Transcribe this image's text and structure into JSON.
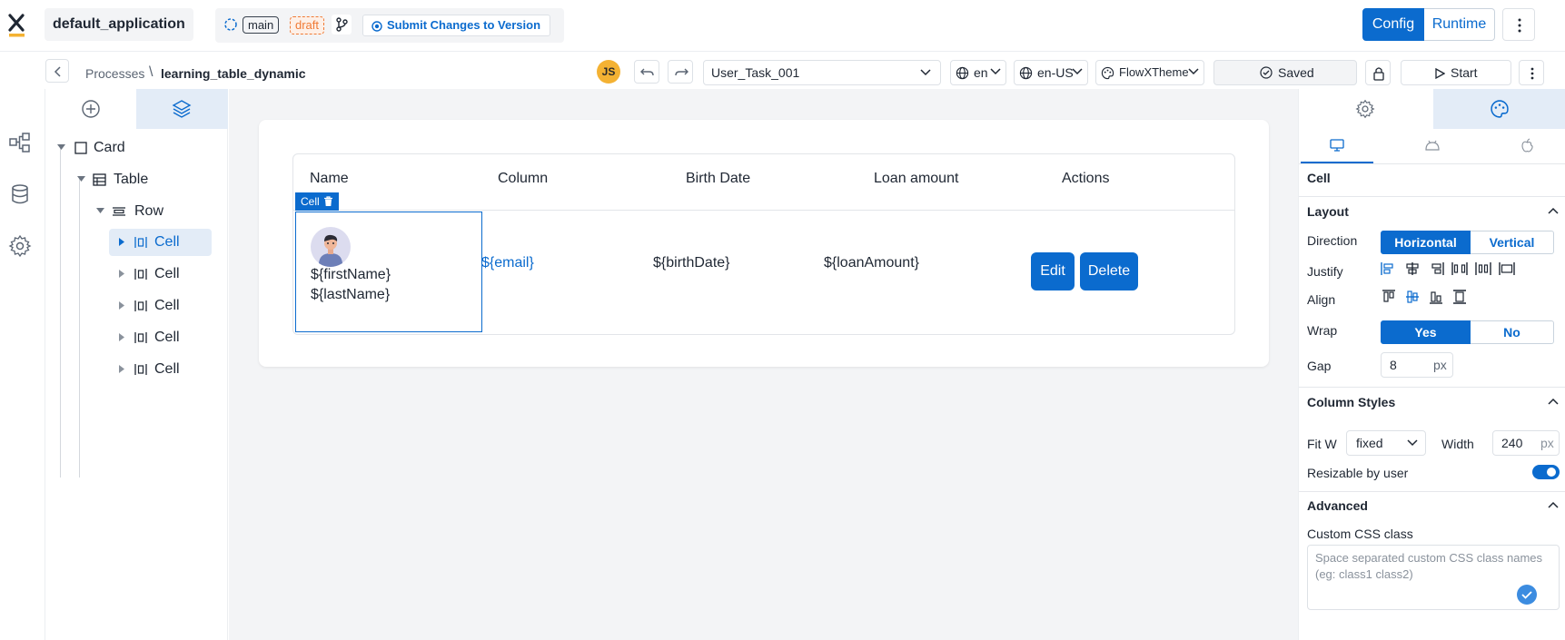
{
  "header": {
    "app_name": "default_application",
    "branch": "main",
    "status": "draft",
    "submit_label": "Submit Changes to Version",
    "mode_config": "Config",
    "mode_runtime": "Runtime"
  },
  "subheader": {
    "breadcrumb_root": "Processes",
    "breadcrumb_sep": "\\",
    "breadcrumb_current": "learning_table_dynamic",
    "user_initials": "JS",
    "task_select": "User_Task_001",
    "language": "en",
    "locale": "en-US",
    "theme": "FlowXTheme",
    "save_status": "Saved",
    "start_label": "Start"
  },
  "tree": {
    "nodes": [
      {
        "label": "Card"
      },
      {
        "label": "Table"
      },
      {
        "label": "Row"
      },
      {
        "label": "Cell"
      },
      {
        "label": "Cell"
      },
      {
        "label": "Cell"
      },
      {
        "label": "Cell"
      },
      {
        "label": "Cell"
      }
    ]
  },
  "table": {
    "headers": [
      "Name",
      "Column",
      "Birth Date",
      "Loan amount",
      "Actions"
    ],
    "selected_tag": "Cell",
    "row": {
      "first_name": "${firstName}",
      "last_name": "${lastName}",
      "email": "${email}",
      "birth_date": "${birthDate}",
      "loan_amount": "${loanAmount}",
      "edit_label": "Edit",
      "delete_label": "Delete"
    }
  },
  "props": {
    "component_name": "Cell",
    "layout_title": "Layout",
    "direction_label": "Direction",
    "direction_options": [
      "Horizontal",
      "Vertical"
    ],
    "justify_label": "Justify",
    "align_label": "Align",
    "wrap_label": "Wrap",
    "wrap_options": [
      "Yes",
      "No"
    ],
    "gap_label": "Gap",
    "gap_value": "8",
    "gap_unit": "px",
    "column_styles_title": "Column Styles",
    "fit_label": "Fit W",
    "fit_value": "fixed",
    "width_label": "Width",
    "width_value": "240",
    "width_unit": "px",
    "resizable_label": "Resizable by user",
    "resizable_on": true,
    "advanced_title": "Advanced",
    "css_label": "Custom CSS class",
    "css_placeholder": "Space separated custom CSS class names (eg: class1 class2)"
  },
  "colors": {
    "accent": "#0b6bce",
    "draft": "#f07a35",
    "avatar": "#f4b233",
    "selection_bg": "#e3ecf7"
  }
}
